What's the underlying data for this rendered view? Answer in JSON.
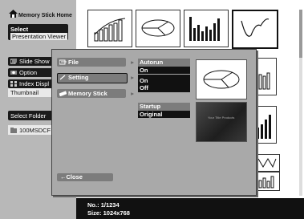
{
  "sidebar": {
    "home_title": "Memory Stick Home",
    "select_label": "Select",
    "select_value": "Presentation Viewer",
    "slide_show": "Slide Show",
    "option": "Option",
    "index_display": "Index Displ",
    "thumbnail": "Thumbnail",
    "select_folder": "Select Folder",
    "folder_name": "100MSDCF"
  },
  "dialog": {
    "menu": [
      {
        "label": "File",
        "icon": "file-icon"
      },
      {
        "label": "Setting",
        "icon": "setting-icon"
      },
      {
        "label": "Memory Stick",
        "icon": "memory-stick-icon"
      }
    ],
    "close_label": "←Close",
    "autorun": {
      "label": "Autorun",
      "value": "On",
      "options": [
        "On",
        "Off"
      ]
    },
    "startup": {
      "label": "Startup",
      "value": "Original"
    },
    "preview_caption": "Your Title Products"
  },
  "info": {
    "no_label": "No.:",
    "no_value": "1/1234",
    "size_label": "Size:",
    "size_value": "1024x768"
  },
  "colors": {
    "sidebar_bg": "#b8b8b8",
    "dialog_bg": "#a9a9a9",
    "menu_item_bg": "#7c7c7c",
    "dark": "#111111"
  }
}
